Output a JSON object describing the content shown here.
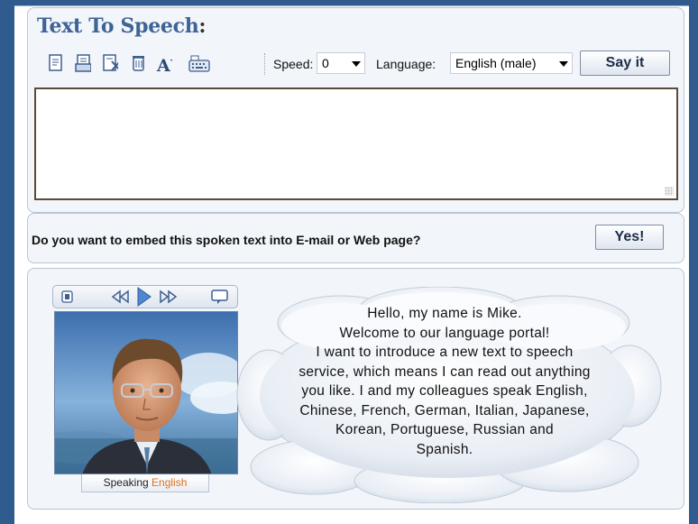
{
  "header": {
    "title": "Text To Speech",
    "title_colon": ":"
  },
  "toolbar": {
    "icons": [
      "new-document-icon",
      "open-document-icon",
      "cut-document-icon",
      "delete-icon",
      "font-size-icon",
      "keyboard-icon"
    ],
    "speed_label": "Speed:",
    "speed_value": "0",
    "language_label": "Language:",
    "language_value": "English (male)",
    "say_button": "Say it"
  },
  "input": {
    "value": ""
  },
  "embed": {
    "question": "Do you want to embed this spoken text into E-mail or Web page?",
    "button": "Yes!"
  },
  "avatar_panel": {
    "player_icons": [
      "menu-icon",
      "rewind-icon",
      "play-icon",
      "fast-forward-icon",
      "speech-bubble-icon"
    ],
    "speaking_label": "Speaking",
    "speaking_language": "English",
    "speech_lines": [
      "Hello, my name is Mike.",
      "Welcome to our language portal!",
      "I want to introduce a new text to speech",
      "service, which means I can read out anything",
      "you like. I and my colleagues speak English,",
      "Chinese, French, German, Italian, Japanese,",
      "Korean, Portuguese, Russian and",
      "Spanish."
    ]
  },
  "colors": {
    "title": "#3d6496",
    "background": "#2f5b8e",
    "panel": "#f2f5fa",
    "accent_language": "#e0701e"
  }
}
